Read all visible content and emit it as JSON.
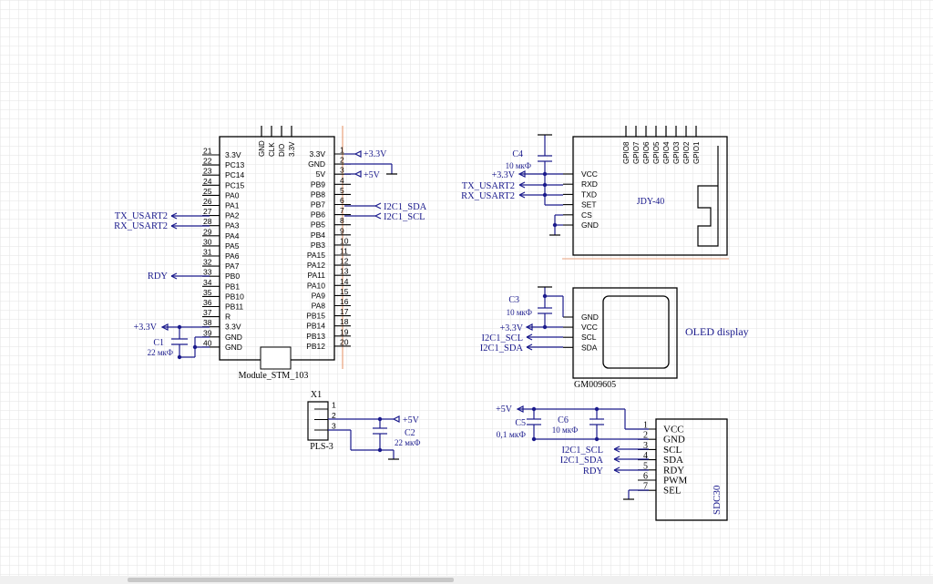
{
  "colors": {
    "wire": "#1a1a8c",
    "body": "#000000",
    "label": "#1a1a8c",
    "grid": "#e3e3e3",
    "accent": "#e8a27c"
  },
  "stm": {
    "name": "Module_STM_103",
    "top_pins": [
      "GND",
      "CLK",
      "DIO",
      "3.3V"
    ],
    "left_pins": [
      {
        "num": "21",
        "name": "3.3V"
      },
      {
        "num": "22",
        "name": "PC13"
      },
      {
        "num": "23",
        "name": "PC14"
      },
      {
        "num": "24",
        "name": "PC15"
      },
      {
        "num": "25",
        "name": "PA0"
      },
      {
        "num": "26",
        "name": "PA1"
      },
      {
        "num": "27",
        "name": "PA2"
      },
      {
        "num": "28",
        "name": "PA3"
      },
      {
        "num": "29",
        "name": "PA4"
      },
      {
        "num": "30",
        "name": "PA5"
      },
      {
        "num": "31",
        "name": "PA6"
      },
      {
        "num": "32",
        "name": "PA7"
      },
      {
        "num": "33",
        "name": "PB0"
      },
      {
        "num": "34",
        "name": "PB1"
      },
      {
        "num": "35",
        "name": "PB10"
      },
      {
        "num": "36",
        "name": "PB11"
      },
      {
        "num": "37",
        "name": "R"
      },
      {
        "num": "38",
        "name": "3.3V"
      },
      {
        "num": "39",
        "name": "GND"
      },
      {
        "num": "40",
        "name": "GND"
      }
    ],
    "right_pins": [
      {
        "num": "1",
        "name": "3.3V"
      },
      {
        "num": "2",
        "name": "GND"
      },
      {
        "num": "3",
        "name": "5V"
      },
      {
        "num": "4",
        "name": "PB9"
      },
      {
        "num": "5",
        "name": "PB8"
      },
      {
        "num": "6",
        "name": "PB7"
      },
      {
        "num": "7",
        "name": "PB6"
      },
      {
        "num": "8",
        "name": "PB5"
      },
      {
        "num": "9",
        "name": "PB4"
      },
      {
        "num": "10",
        "name": "PB3"
      },
      {
        "num": "11",
        "name": "PA15"
      },
      {
        "num": "12",
        "name": "PA12"
      },
      {
        "num": "13",
        "name": "PA11"
      },
      {
        "num": "14",
        "name": "PA10"
      },
      {
        "num": "15",
        "name": "PA9"
      },
      {
        "num": "16",
        "name": "PA8"
      },
      {
        "num": "17",
        "name": "PB15"
      },
      {
        "num": "18",
        "name": "PB14"
      },
      {
        "num": "19",
        "name": "PB13"
      },
      {
        "num": "20",
        "name": "PB12"
      }
    ]
  },
  "nets": {
    "stm_tx": "TX_USART2",
    "stm_rx": "RX_USART2",
    "stm_rdy": "RDY",
    "stm_33v": "+3.3V",
    "stm_sda": "I2C1_SDA",
    "stm_scl": "I2C1_SCL",
    "stm_pwr33": "+3.3V",
    "stm_pwr5": "+5V",
    "x1_5v": "+5V",
    "jdy_33v": "+3.3V",
    "jdy_tx": "TX_USART2",
    "jdy_rx": "RX_USART2",
    "oled_33v": "+3.3V",
    "oled_scl": "I2C1_SCL",
    "oled_sda": "I2C1_SDA",
    "sdc_5v": "+5V",
    "sdc_scl": "I2C1_SCL",
    "sdc_sda": "I2C1_SDA",
    "sdc_rdy": "RDY"
  },
  "caps": {
    "c1": {
      "ref": "C1",
      "value": "22 мкФ"
    },
    "c2": {
      "ref": "C2",
      "value": "22 мкФ"
    },
    "c3": {
      "ref": "C3",
      "value": "10 мкФ"
    },
    "c4": {
      "ref": "C4",
      "value": "10 мкФ"
    },
    "c5": {
      "ref": "C5",
      "value": "0,1 мкФ"
    },
    "c6": {
      "ref": "C6",
      "value": "10 мкФ"
    }
  },
  "x1": {
    "ref": "X1",
    "name": "PLS-3",
    "pins": [
      "1",
      "2",
      "3"
    ]
  },
  "jdy": {
    "name": "JDY-40",
    "gpio": [
      "GPIO8",
      "GPIO7",
      "GPIO6",
      "GPIO5",
      "GPIO4",
      "GPIO3",
      "GPIO2",
      "GPIO1"
    ],
    "pins": [
      "VCC",
      "RXD",
      "TXD",
      "SET",
      "CS",
      "GND"
    ]
  },
  "oled": {
    "title": "OLED display",
    "part": "GM009605",
    "pins": [
      "GND",
      "VCC",
      "SCL",
      "SDA"
    ]
  },
  "sdc": {
    "name": "SDC30",
    "pins": [
      {
        "num": "1",
        "name": "VCC"
      },
      {
        "num": "2",
        "name": "GND"
      },
      {
        "num": "3",
        "name": "SCL"
      },
      {
        "num": "4",
        "name": "SDA"
      },
      {
        "num": "5",
        "name": "RDY"
      },
      {
        "num": "6",
        "name": "PWM"
      },
      {
        "num": "7",
        "name": "SEL"
      }
    ]
  }
}
